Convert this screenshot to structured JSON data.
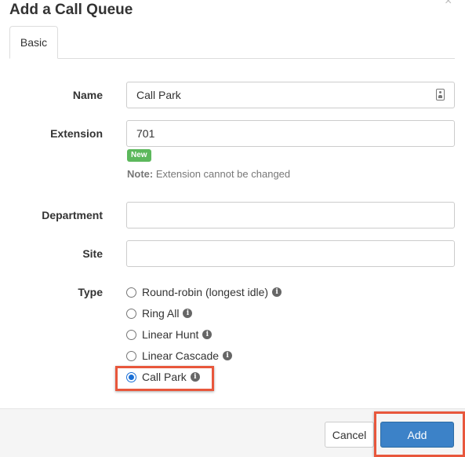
{
  "dialog": {
    "title": "Add a Call Queue",
    "close_glyph": "×"
  },
  "tabs": [
    {
      "label": "Basic",
      "active": true
    }
  ],
  "form": {
    "name": {
      "label": "Name",
      "value": "Call Park"
    },
    "extension": {
      "label": "Extension",
      "value": "701",
      "badge": "New",
      "note_prefix": "Note:",
      "note_text": " Extension cannot be changed"
    },
    "department": {
      "label": "Department",
      "value": ""
    },
    "site": {
      "label": "Site",
      "value": ""
    },
    "type": {
      "label": "Type",
      "options": [
        {
          "label": "Round-robin (longest idle)",
          "selected": false
        },
        {
          "label": "Ring All",
          "selected": false
        },
        {
          "label": "Linear Hunt",
          "selected": false
        },
        {
          "label": "Linear Cascade",
          "selected": false
        },
        {
          "label": "Call Park",
          "selected": true
        }
      ]
    }
  },
  "footer": {
    "cancel_label": "Cancel",
    "add_label": "Add"
  },
  "icons": {
    "info": "info-icon",
    "contact": "contact-card-icon",
    "close": "close-icon"
  },
  "colors": {
    "primary_button": "#3c82c8",
    "badge_new": "#5cb85c",
    "highlight": "#e8573c",
    "radio_selected": "#1a6fd6"
  }
}
